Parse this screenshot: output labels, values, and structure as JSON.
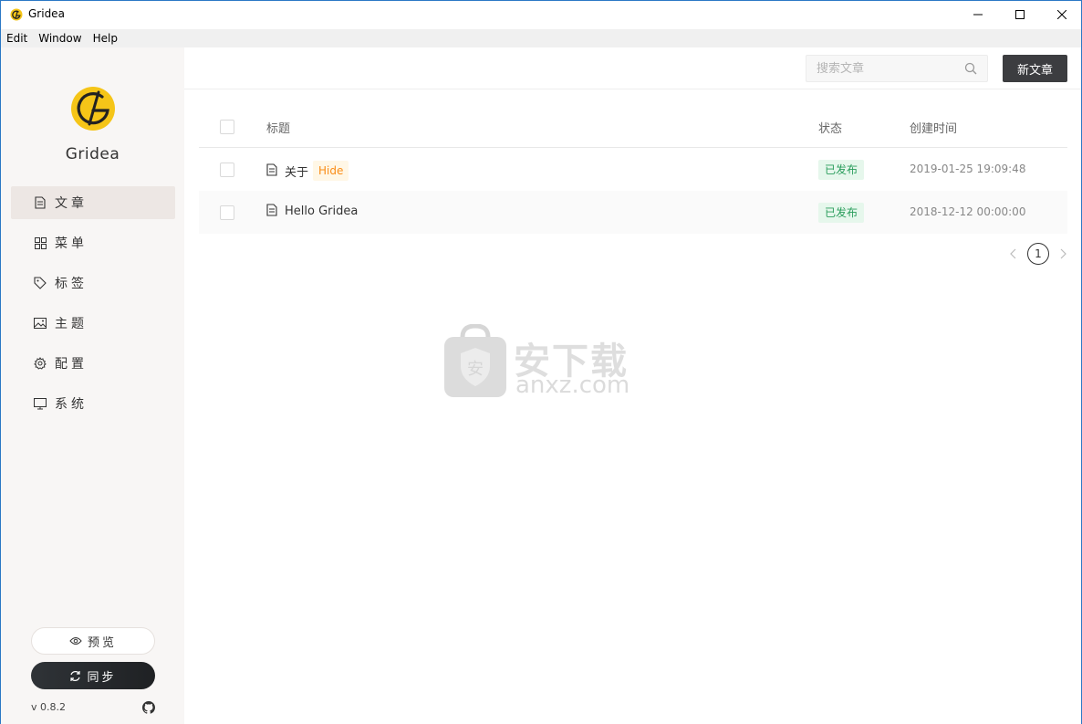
{
  "window": {
    "title": "Gridea",
    "menu": [
      "Edit",
      "Window",
      "Help"
    ]
  },
  "sidebar": {
    "brand": "Gridea",
    "items": [
      {
        "label": "文章",
        "icon": "document-icon",
        "active": true
      },
      {
        "label": "菜单",
        "icon": "grid-icon",
        "active": false
      },
      {
        "label": "标签",
        "icon": "tag-icon",
        "active": false
      },
      {
        "label": "主题",
        "icon": "image-icon",
        "active": false
      },
      {
        "label": "配置",
        "icon": "gear-icon",
        "active": false
      },
      {
        "label": "系统",
        "icon": "monitor-icon",
        "active": false
      }
    ],
    "preview_label": "预览",
    "sync_label": "同步",
    "version": "v 0.8.2"
  },
  "toolbar": {
    "search_placeholder": "搜索文章",
    "new_button": "新文章"
  },
  "table": {
    "headers": {
      "title": "标题",
      "status": "状态",
      "created": "创建时间"
    },
    "rows": [
      {
        "title": "关于",
        "tag": "Hide",
        "status": "已发布",
        "created": "2019-01-25 19:09:48"
      },
      {
        "title": "Hello Gridea",
        "tag": "",
        "status": "已发布",
        "created": "2018-12-12 00:00:00"
      }
    ]
  },
  "pagination": {
    "current": "1"
  },
  "watermark": {
    "text": "安下载",
    "sub": "anxz.com"
  },
  "colors": {
    "accent": "#f5c518",
    "dark_button": "#3c3d40",
    "published_bg": "#e6f7ec",
    "hide_bg": "#fff7e6"
  }
}
